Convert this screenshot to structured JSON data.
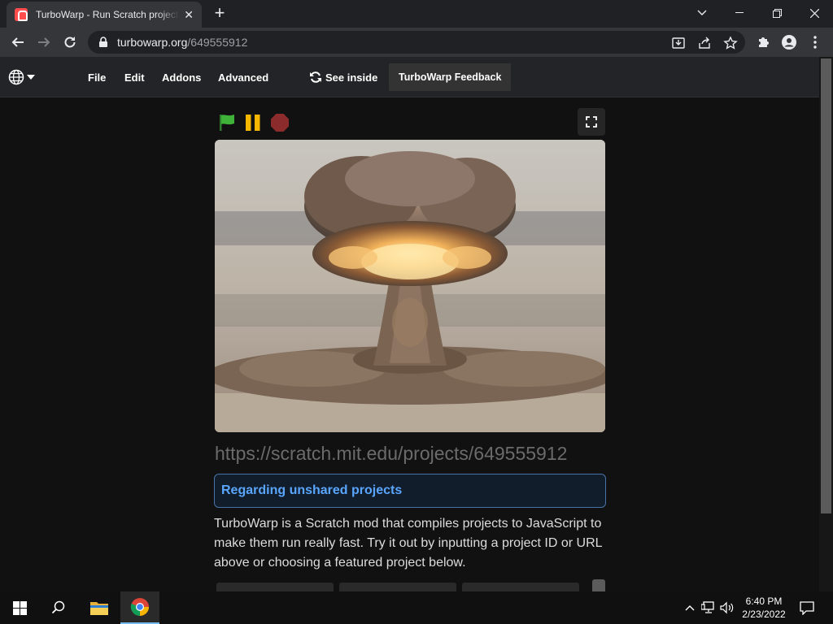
{
  "browser": {
    "tab_title": "TurboWarp - Run Scratch projects faster",
    "new_tab_label": "+",
    "url_host": "turbowarp.org",
    "url_path": "/649555912"
  },
  "menubar": {
    "file": "File",
    "edit": "Edit",
    "addons": "Addons",
    "advanced": "Advanced",
    "see_inside": "See inside",
    "feedback": "TurboWarp Feedback"
  },
  "player": {
    "project_url": "https://scratch.mit.edu/projects/649555912"
  },
  "notice": {
    "title": "Regarding unshared projects"
  },
  "description": "TurboWarp is a Scratch mod that compiles projects to JavaScript to make them run really fast. Try it out by inputting a project ID or URL above or choosing a featured project below.",
  "taskbar": {
    "time": "6:40 PM",
    "date": "2/23/2022"
  },
  "colors": {
    "notice_text": "#5aa6ff",
    "green_flag": "#3fb23a",
    "pause": "#f5b700",
    "stop": "#8b2b2b"
  }
}
